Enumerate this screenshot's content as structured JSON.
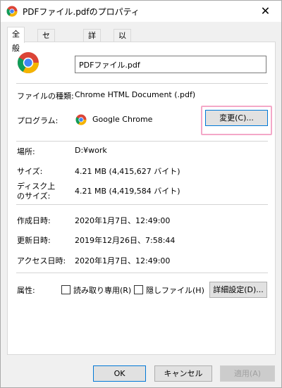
{
  "window": {
    "title": "PDFファイル.pdfのプロパティ",
    "close_glyph": "✕"
  },
  "tabs": [
    {
      "label": "全般",
      "active": true
    },
    {
      "label": "セキュリティ",
      "active": false
    },
    {
      "label": "詳細",
      "active": false
    },
    {
      "label": "以前のバージョン",
      "active": false
    }
  ],
  "general": {
    "file_name": "PDFファイル.pdf",
    "file_type_label": "ファイルの種類:",
    "file_type_value": "Chrome HTML Document (.pdf)",
    "program_label": "プログラム:",
    "program_value": "Google Chrome",
    "change_button": "変更(C)...",
    "location_label": "場所:",
    "location_value": "D:¥work",
    "size_label": "サイズ:",
    "size_value": "4.21 MB (4,415,627 バイト)",
    "size_on_disk_label_1": "ディスク上",
    "size_on_disk_label_2": "のサイズ:",
    "size_on_disk_value": "4.21 MB (4,419,584 バイト)",
    "created_label": "作成日時:",
    "created_value": "2020年1月7日、12:49:00",
    "modified_label": "更新日時:",
    "modified_value": "2019年12月26日、7:58:44",
    "accessed_label": "アクセス日時:",
    "accessed_value": "2020年1月7日、12:49:00",
    "attributes_label": "属性:",
    "readonly_label": "読み取り専用(R)",
    "hidden_label": "隠しファイル(H)",
    "advanced_button": "詳細設定(D)..."
  },
  "footer": {
    "ok": "OK",
    "cancel": "キャンセル",
    "apply": "適用(A)"
  },
  "colors": {
    "chrome_red": "#db4437",
    "chrome_yellow": "#f4b400",
    "chrome_green": "#0f9d58",
    "chrome_blue": "#4285f4",
    "highlight": "#f4a8c8"
  }
}
